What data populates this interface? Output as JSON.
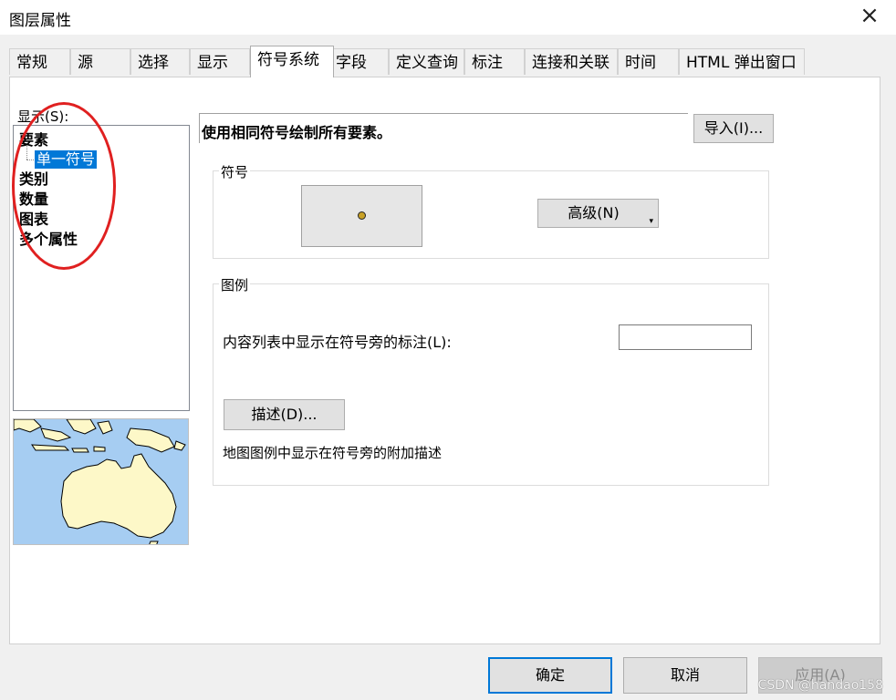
{
  "window": {
    "title": "图层属性",
    "close_glyph": "×"
  },
  "tabs": [
    {
      "label": "常规"
    },
    {
      "label": "源"
    },
    {
      "label": "选择"
    },
    {
      "label": "显示"
    },
    {
      "label": "符号系统",
      "active": true
    },
    {
      "label": "字段"
    },
    {
      "label": "定义查询"
    },
    {
      "label": "标注"
    },
    {
      "label": "连接和关联"
    },
    {
      "label": "时间"
    },
    {
      "label": "HTML 弹出窗口"
    }
  ],
  "sidebar": {
    "show_label": "显示(S):",
    "tree": [
      {
        "label": "要素"
      },
      {
        "label": "单一符号",
        "selected": true
      },
      {
        "label": "类别"
      },
      {
        "label": "数量"
      },
      {
        "label": "图表"
      },
      {
        "label": "多个属性"
      }
    ],
    "preview_icon": "map-preview",
    "preview_colors": {
      "water": "#a6cdf2",
      "land": "#fdf8c8",
      "outline": "#000000"
    }
  },
  "main": {
    "description": "使用相同符号绘制所有要素。",
    "import_button": "导入(I)...",
    "symbol_group": {
      "title": "符号",
      "advanced_button": "高级(N)",
      "dropdown_glyph": "▾",
      "symbol_color": "#c9a227"
    },
    "legend_group": {
      "title": "图例",
      "label_prompt": "内容列表中显示在符号旁的标注(L):",
      "label_value": "",
      "describe_button": "描述(D)...",
      "describe_hint": "地图图例中显示在符号旁的附加描述"
    }
  },
  "footer": {
    "ok": "确定",
    "cancel": "取消",
    "apply": "应用(A)"
  },
  "annotation": {
    "color": "#e02020"
  },
  "watermark": "CSDN @handao158"
}
